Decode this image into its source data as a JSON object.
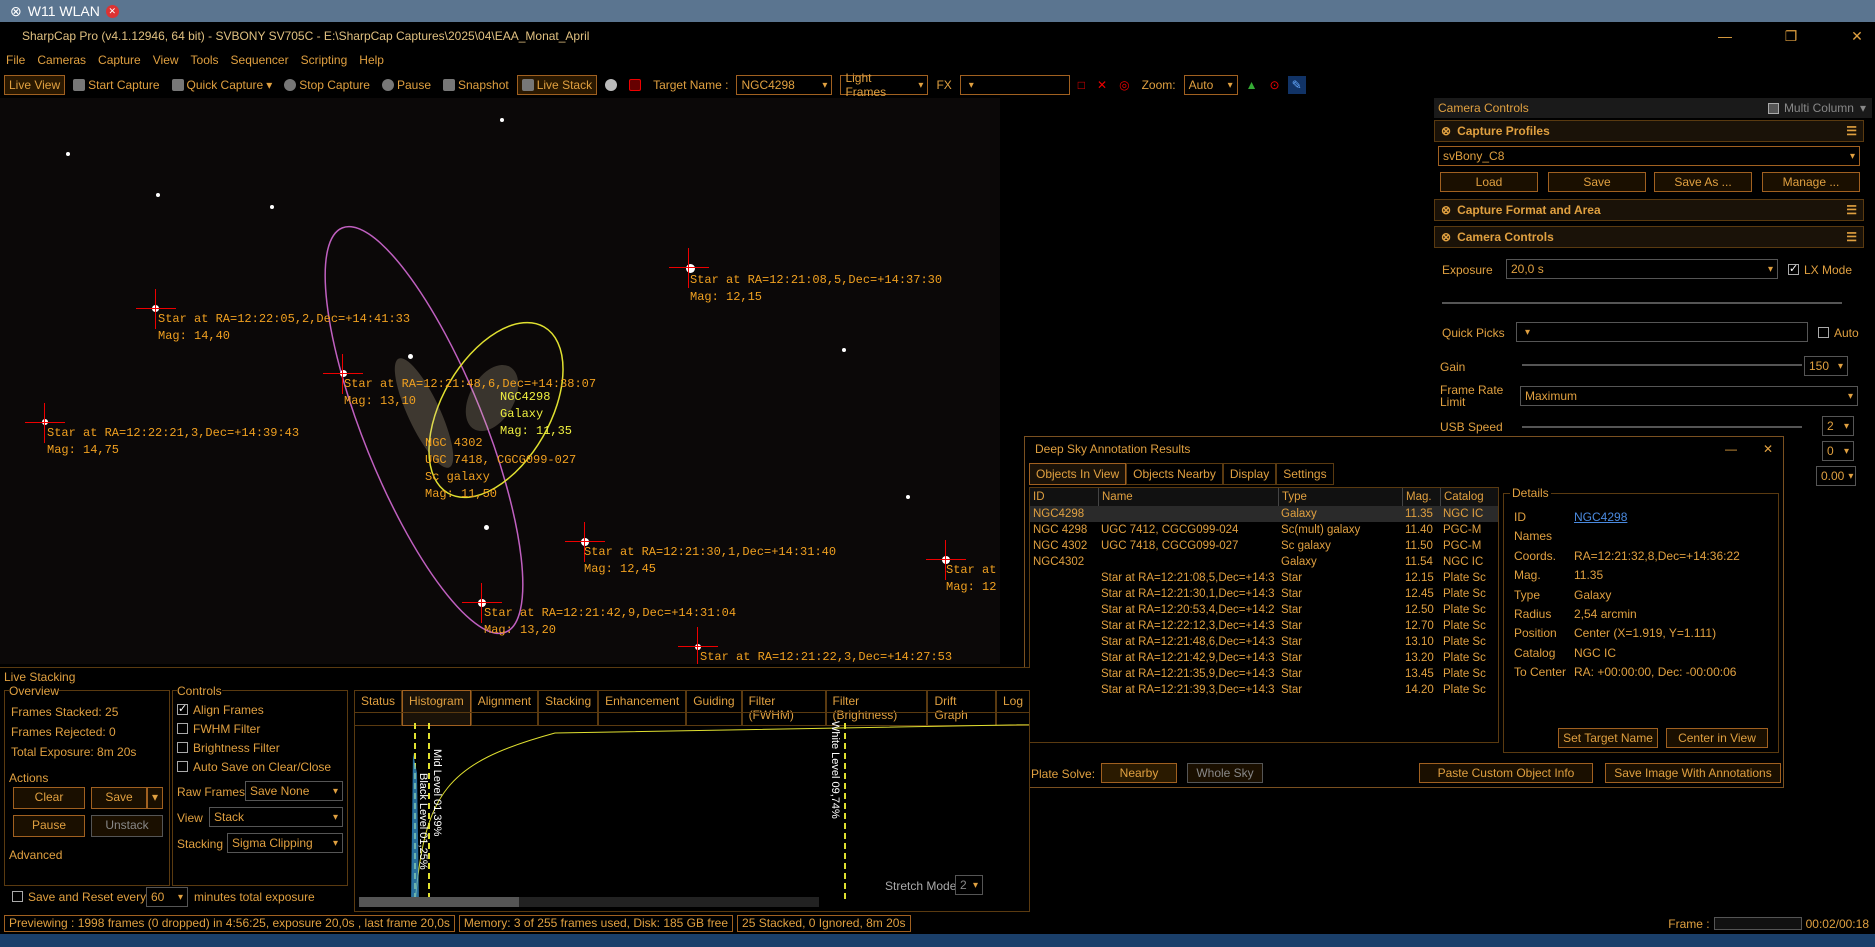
{
  "ribbon": {
    "tab": "W11 WLAN"
  },
  "window": {
    "title": "SharpCap Pro (v4.1.12946, 64 bit) - SVBONY SV705C - E:\\SharpCap Captures\\2025\\04\\EAA_Monat_April",
    "min": "—",
    "max": "❐",
    "close": "✕"
  },
  "menu": [
    "File",
    "Cameras",
    "Capture",
    "View",
    "Tools",
    "Sequencer",
    "Scripting",
    "Help"
  ],
  "toolbar": {
    "live_view": "Live View",
    "start_capture": "Start Capture",
    "quick_capture": "Quick Capture",
    "stop_capture": "Stop Capture",
    "pause": "Pause",
    "snapshot": "Snapshot",
    "live_stack": "Live Stack",
    "target_label": "Target Name :",
    "target_value": "NGC4298",
    "frames_value": "Light Frames",
    "fx_label": "FX",
    "fx_value": "",
    "zoom_label": "Zoom:",
    "zoom_value": "Auto"
  },
  "annotations": [
    {
      "text": "Star at RA=12:21:08,5,Dec=+14:37:30\nMag: 12,15"
    },
    {
      "text": "Star at RA=12:22:05,2,Dec=+14:41:33\nMag: 14,40"
    },
    {
      "text": "Star at RA=12:21:48,6,Dec=+14:38:07\nMag: 13,10"
    },
    {
      "text": "NGC4298\nGalaxy\nMag: 11,35"
    },
    {
      "text": "Star at RA=12:22:21,3,Dec=+14:39:43\nMag: 14,75"
    },
    {
      "text": "NGC 4302\nUGC 7418, CGCG099-027\nSc galaxy\nMag: 11,50"
    },
    {
      "text": "Star at RA=12:21:30,1,Dec=+14:31:40\nMag: 12,45"
    },
    {
      "text": "Star at\nMag: 12"
    },
    {
      "text": "Star at RA=12:21:42,9,Dec=+14:31:04\nMag: 13,20"
    },
    {
      "text": "Star at RA=12:21:22,3,Dec=+14:27:53"
    }
  ],
  "camera_controls": {
    "title": "Camera Controls",
    "multi_column": "Multi Column",
    "capture_profiles": "Capture Profiles",
    "profile_value": "svBony_C8",
    "load": "Load",
    "save": "Save",
    "save_as": "Save As ...",
    "manage": "Manage ...",
    "capture_format": "Capture Format and Area",
    "camera_controls_hdr": "Camera Controls",
    "exposure_label": "Exposure",
    "exposure_value": "20,0 s",
    "lx_mode": "LX Mode",
    "quick_picks": "Quick Picks",
    "auto": "Auto",
    "gain_label": "Gain",
    "gain_value": "150",
    "frame_rate_label": "Frame Rate Limit",
    "frame_rate_value": "Maximum",
    "usb_speed_label": "USB Speed",
    "usb_value": "2",
    "v0": "0",
    "v000": "0.00"
  },
  "dsa": {
    "title": "Deep Sky Annotation Results",
    "tabs": [
      "Objects In View",
      "Objects Nearby",
      "Display",
      "Settings"
    ],
    "columns": [
      "ID",
      "Name",
      "Type",
      "Mag.",
      "Catalog"
    ],
    "rows": [
      [
        "NGC4298",
        "",
        "Galaxy",
        "11.35",
        "NGC IC"
      ],
      [
        "NGC 4298",
        "UGC 7412, CGCG099-024",
        "Sc(mult) galaxy",
        "11.40",
        "PGC-M"
      ],
      [
        "NGC 4302",
        "UGC 7418, CGCG099-027",
        "Sc galaxy",
        "11.50",
        "PGC-M"
      ],
      [
        "NGC4302",
        "",
        "Galaxy",
        "11.54",
        "NGC IC"
      ],
      [
        "",
        "Star at RA=12:21:08,5,Dec=+14:3",
        "Star",
        "12.15",
        "Plate Sc"
      ],
      [
        "",
        "Star at RA=12:21:30,1,Dec=+14:3",
        "Star",
        "12.45",
        "Plate Sc"
      ],
      [
        "",
        "Star at RA=12:20:53,4,Dec=+14:2",
        "Star",
        "12.50",
        "Plate Sc"
      ],
      [
        "",
        "Star at RA=12:22:12,3,Dec=+14:3",
        "Star",
        "12.70",
        "Plate Sc"
      ],
      [
        "",
        "Star at RA=12:21:48,6,Dec=+14:3",
        "Star",
        "13.10",
        "Plate Sc"
      ],
      [
        "",
        "Star at RA=12:21:42,9,Dec=+14:3",
        "Star",
        "13.20",
        "Plate Sc"
      ],
      [
        "",
        "Star at RA=12:21:35,9,Dec=+14:3",
        "Star",
        "13.45",
        "Plate Sc"
      ],
      [
        "",
        "Star at RA=12:21:39,3,Dec=+14:3",
        "Star",
        "14.20",
        "Plate Sc"
      ]
    ],
    "details_title": "Details",
    "details": [
      [
        "ID",
        "NGC4298"
      ],
      [
        "Names",
        ""
      ],
      [
        "Coords.",
        "RA=12:21:32,8,Dec=+14:36:22"
      ],
      [
        "Mag.",
        "11.35"
      ],
      [
        "Type",
        "Galaxy"
      ],
      [
        "Radius",
        "2,54 arcmin"
      ],
      [
        "Position",
        "Center (X=1.919, Y=1.111)"
      ],
      [
        "Catalog",
        "NGC IC"
      ],
      [
        "To Center",
        "RA: +00:00:00, Dec: -00:00:06"
      ]
    ],
    "set_target": "Set Target Name",
    "center_view": "Center in View",
    "plate_solve": "Plate Solve:",
    "nearby": "Nearby",
    "whole_sky": "Whole Sky",
    "paste_custom": "Paste Custom Object Info",
    "save_image": "Save Image With Annotations"
  },
  "live_stacking": {
    "title": "Live Stacking",
    "overview": "Overview",
    "frames_stacked": "Frames Stacked:  25",
    "frames_rejected": "Frames Rejected:  0",
    "total_exposure": "Total Exposure:   8m 20s",
    "actions": "Actions",
    "clear": "Clear",
    "save": "Save",
    "pause": "Pause",
    "unstack": "Unstack",
    "advanced": "Advanced",
    "save_reset": "Save and Reset every",
    "save_reset_value": "60",
    "minutes": "minutes total exposure",
    "controls": "Controls",
    "align": "Align Frames",
    "fwhm": "FWHM Filter",
    "brightness": "Brightness Filter",
    "autosave": "Auto Save on Clear/Close",
    "raw_frames": "Raw Frames",
    "raw_value": "Save None",
    "view": "View",
    "view_value": "Stack",
    "stacking": "Stacking",
    "stacking_value": "Sigma Clipping",
    "tabs": [
      "Status",
      "Histogram",
      "Alignment",
      "Stacking",
      "Enhancement",
      "Guiding",
      "Filter (FWHM)",
      "Filter (Brightness)",
      "Drift Graph",
      "Log"
    ],
    "white_level": "White Level 09,74%",
    "mid_level": "Mid Level 01,39%",
    "black_level": "Black Level 01,25%",
    "stretch_mode": "Stretch Mode",
    "stretch_value": "2"
  },
  "status": {
    "preview": "Previewing : 1998 frames (0 dropped) in 4:56:25, exposure 20,0s , last frame 20,0s",
    "memory": "Memory: 3 of 255 frames used, Disk: 185 GB free",
    "stacked": "25 Stacked, 0 Ignored, 8m 20s",
    "frame_label": "Frame :",
    "time": "00:02/00:18"
  }
}
